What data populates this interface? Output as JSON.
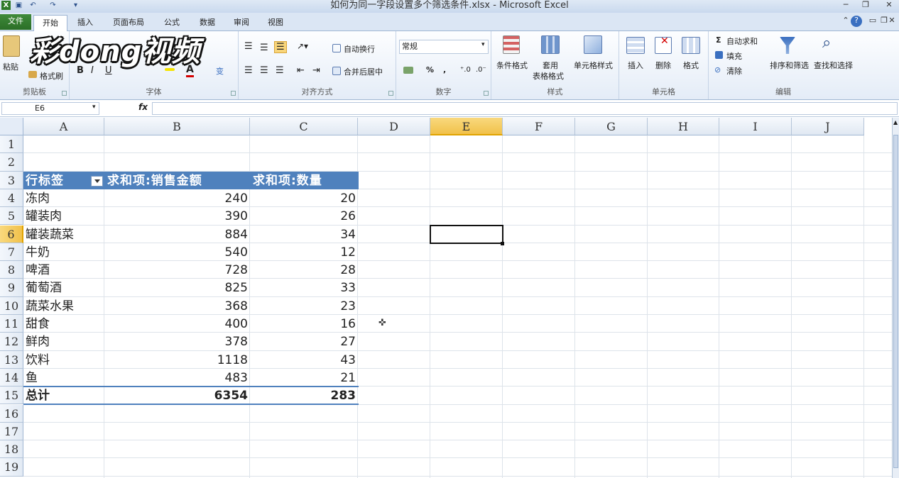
{
  "window": {
    "title": "如何为同一字段设置多个筛选条件.xlsx - Microsoft Excel",
    "controls": {
      "minimize": "─",
      "restore": "❐",
      "close": "✕"
    }
  },
  "tabs": {
    "file": "文件",
    "home": "开始",
    "insert": "插入",
    "page_layout": "页面布局",
    "formulas": "公式",
    "data": "数据",
    "review": "审阅",
    "view": "视图"
  },
  "watermark": "彩dong视频",
  "ribbon": {
    "clipboard": {
      "label": "剪贴板",
      "paste": "粘贴",
      "format_painter": "格式刷"
    },
    "font": {
      "label": "字体",
      "bold": "B",
      "italic": "I",
      "underline": "U",
      "font_color": "A",
      "pinyin": "变"
    },
    "alignment": {
      "label": "对齐方式",
      "wrap": "自动换行",
      "merge": "合并后居中"
    },
    "number": {
      "label": "数字",
      "format_value": "常规",
      "percent": "%",
      "comma": ","
    },
    "styles": {
      "label": "样式",
      "conditional": "条件格式",
      "table_line1": "套用",
      "table_line2": "表格格式",
      "cell_styles": "单元格样式"
    },
    "cells": {
      "label": "单元格",
      "insert": "插入",
      "delete": "删除",
      "format": "格式"
    },
    "editing": {
      "label": "编辑",
      "autosum": "自动求和",
      "fill": "填充",
      "clear": "清除",
      "sort": "排序和筛选",
      "find": "查找和选择"
    }
  },
  "formula_bar": {
    "name_box": "E6",
    "fx": "fx",
    "value": ""
  },
  "columns": [
    "A",
    "B",
    "C",
    "D",
    "E",
    "F",
    "G",
    "H",
    "I",
    "J"
  ],
  "selected_column": "E",
  "rows": [
    "1",
    "2",
    "3",
    "4",
    "5",
    "6",
    "7",
    "8",
    "9",
    "10",
    "11",
    "12",
    "13",
    "14",
    "15",
    "16",
    "17",
    "18",
    "19"
  ],
  "selected_row": "6",
  "pivot": {
    "headers": [
      "行标签",
      "求和项:销售金额",
      "求和项:数量"
    ],
    "rows": [
      [
        "冻肉",
        "240",
        "20"
      ],
      [
        "罐装肉",
        "390",
        "26"
      ],
      [
        "罐装蔬菜",
        "884",
        "34"
      ],
      [
        "牛奶",
        "540",
        "12"
      ],
      [
        "啤酒",
        "728",
        "28"
      ],
      [
        "葡萄酒",
        "825",
        "33"
      ],
      [
        "蔬菜水果",
        "368",
        "23"
      ],
      [
        "甜食",
        "400",
        "16"
      ],
      [
        "鲜肉",
        "378",
        "27"
      ],
      [
        "饮料",
        "1118",
        "43"
      ],
      [
        "鱼",
        "483",
        "21"
      ]
    ],
    "total": [
      "总计",
      "6354",
      "283"
    ]
  }
}
